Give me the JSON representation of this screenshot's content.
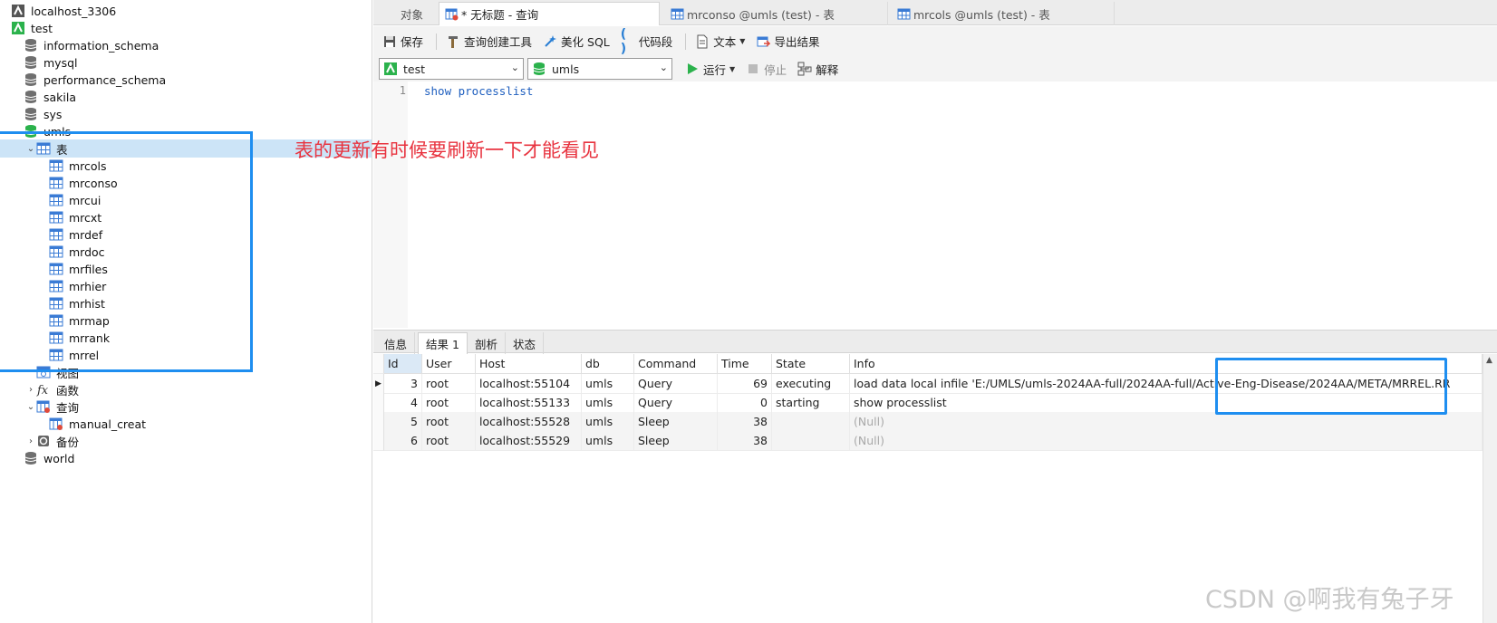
{
  "tree": {
    "items": [
      {
        "label": "localhost_3306",
        "icon": "server-icon",
        "arrow": "",
        "indent": 0,
        "selected": false
      },
      {
        "label": "test",
        "icon": "connection-icon",
        "arrow": "",
        "indent": 0,
        "selected": false
      },
      {
        "label": "information_schema",
        "icon": "database-icon",
        "arrow": "",
        "indent": 1,
        "selected": false
      },
      {
        "label": "mysql",
        "icon": "database-icon",
        "arrow": "",
        "indent": 1,
        "selected": false
      },
      {
        "label": "performance_schema",
        "icon": "database-icon",
        "arrow": "",
        "indent": 1,
        "selected": false
      },
      {
        "label": "sakila",
        "icon": "database-icon",
        "arrow": "",
        "indent": 1,
        "selected": false
      },
      {
        "label": "sys",
        "icon": "database-icon",
        "arrow": "",
        "indent": 1,
        "selected": false
      },
      {
        "label": "umls",
        "icon": "database-open-icon",
        "arrow": "expanded",
        "indent": 1,
        "selected": false
      },
      {
        "label": "表",
        "icon": "table-folder-icon",
        "arrow": "expanded",
        "indent": 2,
        "selected": true
      },
      {
        "label": "mrcols",
        "icon": "table-icon",
        "arrow": "",
        "indent": 3,
        "selected": false
      },
      {
        "label": "mrconso",
        "icon": "table-icon",
        "arrow": "",
        "indent": 3,
        "selected": false
      },
      {
        "label": "mrcui",
        "icon": "table-icon",
        "arrow": "",
        "indent": 3,
        "selected": false
      },
      {
        "label": "mrcxt",
        "icon": "table-icon",
        "arrow": "",
        "indent": 3,
        "selected": false
      },
      {
        "label": "mrdef",
        "icon": "table-icon",
        "arrow": "",
        "indent": 3,
        "selected": false
      },
      {
        "label": "mrdoc",
        "icon": "table-icon",
        "arrow": "",
        "indent": 3,
        "selected": false
      },
      {
        "label": "mrfiles",
        "icon": "table-icon",
        "arrow": "",
        "indent": 3,
        "selected": false
      },
      {
        "label": "mrhier",
        "icon": "table-icon",
        "arrow": "",
        "indent": 3,
        "selected": false
      },
      {
        "label": "mrhist",
        "icon": "table-icon",
        "arrow": "",
        "indent": 3,
        "selected": false
      },
      {
        "label": "mrmap",
        "icon": "table-icon",
        "arrow": "",
        "indent": 3,
        "selected": false
      },
      {
        "label": "mrrank",
        "icon": "table-icon",
        "arrow": "",
        "indent": 3,
        "selected": false
      },
      {
        "label": "mrrel",
        "icon": "table-icon",
        "arrow": "",
        "indent": 3,
        "selected": false
      },
      {
        "label": "视图",
        "icon": "view-icon",
        "arrow": "",
        "indent": 2,
        "selected": false
      },
      {
        "label": "函数",
        "icon": "function-icon",
        "arrow": "collapsed",
        "indent": 2,
        "selected": false
      },
      {
        "label": "查询",
        "icon": "query-folder-icon",
        "arrow": "expanded",
        "indent": 2,
        "selected": false
      },
      {
        "label": "manual_creat",
        "icon": "query-icon",
        "arrow": "",
        "indent": 3,
        "selected": false
      },
      {
        "label": "备份",
        "icon": "backup-icon",
        "arrow": "collapsed",
        "indent": 2,
        "selected": false
      },
      {
        "label": "world",
        "icon": "database-icon",
        "arrow": "",
        "indent": 1,
        "selected": false
      }
    ]
  },
  "tabs": {
    "objects": "对象",
    "query": "* 无标题 - 查询",
    "mrconso": "mrconso @umls (test) - 表",
    "mrcols": "mrcols @umls (test) - 表"
  },
  "toolbar": {
    "save": "保存",
    "query_builder": "查询创建工具",
    "beautify": "美化 SQL",
    "snippet": "代码段",
    "text": "文本",
    "export": "导出结果"
  },
  "selectors": {
    "connection": "test",
    "database": "umls",
    "run": "运行",
    "stop": "停止",
    "explain": "解释"
  },
  "editor": {
    "line_number": "1",
    "code": "show processlist"
  },
  "result_tabs": {
    "info": "信息",
    "result1": "结果 1",
    "profile": "剖析",
    "status": "状态"
  },
  "grid": {
    "columns": [
      "Id",
      "User",
      "Host",
      "db",
      "Command",
      "Time",
      "State",
      "Info"
    ],
    "rows": [
      {
        "Id": "3",
        "User": "root",
        "Host": "localhost:55104",
        "db": "umls",
        "Command": "Query",
        "Time": "69",
        "State": "executing",
        "Info": "load data local infile 'E:/UMLS/umls-2024AA-full/2024AA-full/Active-Eng-Disease/2024AA/META/MRREL.RR",
        "current": true
      },
      {
        "Id": "4",
        "User": "root",
        "Host": "localhost:55133",
        "db": "umls",
        "Command": "Query",
        "Time": "0",
        "State": "starting",
        "Info": "show processlist",
        "current": false
      },
      {
        "Id": "5",
        "User": "root",
        "Host": "localhost:55528",
        "db": "umls",
        "Command": "Sleep",
        "Time": "38",
        "State": "",
        "Info": "(Null)",
        "current": false
      },
      {
        "Id": "6",
        "User": "root",
        "Host": "localhost:55529",
        "db": "umls",
        "Command": "Sleep",
        "Time": "38",
        "State": "",
        "Info": "(Null)",
        "current": false
      }
    ]
  },
  "annotation": {
    "text": "表的更新有时候要刷新一下才能看见",
    "color": "#e8333f",
    "box_color": "#1e8ef0"
  },
  "watermark": "CSDN @啊我有兔子牙"
}
